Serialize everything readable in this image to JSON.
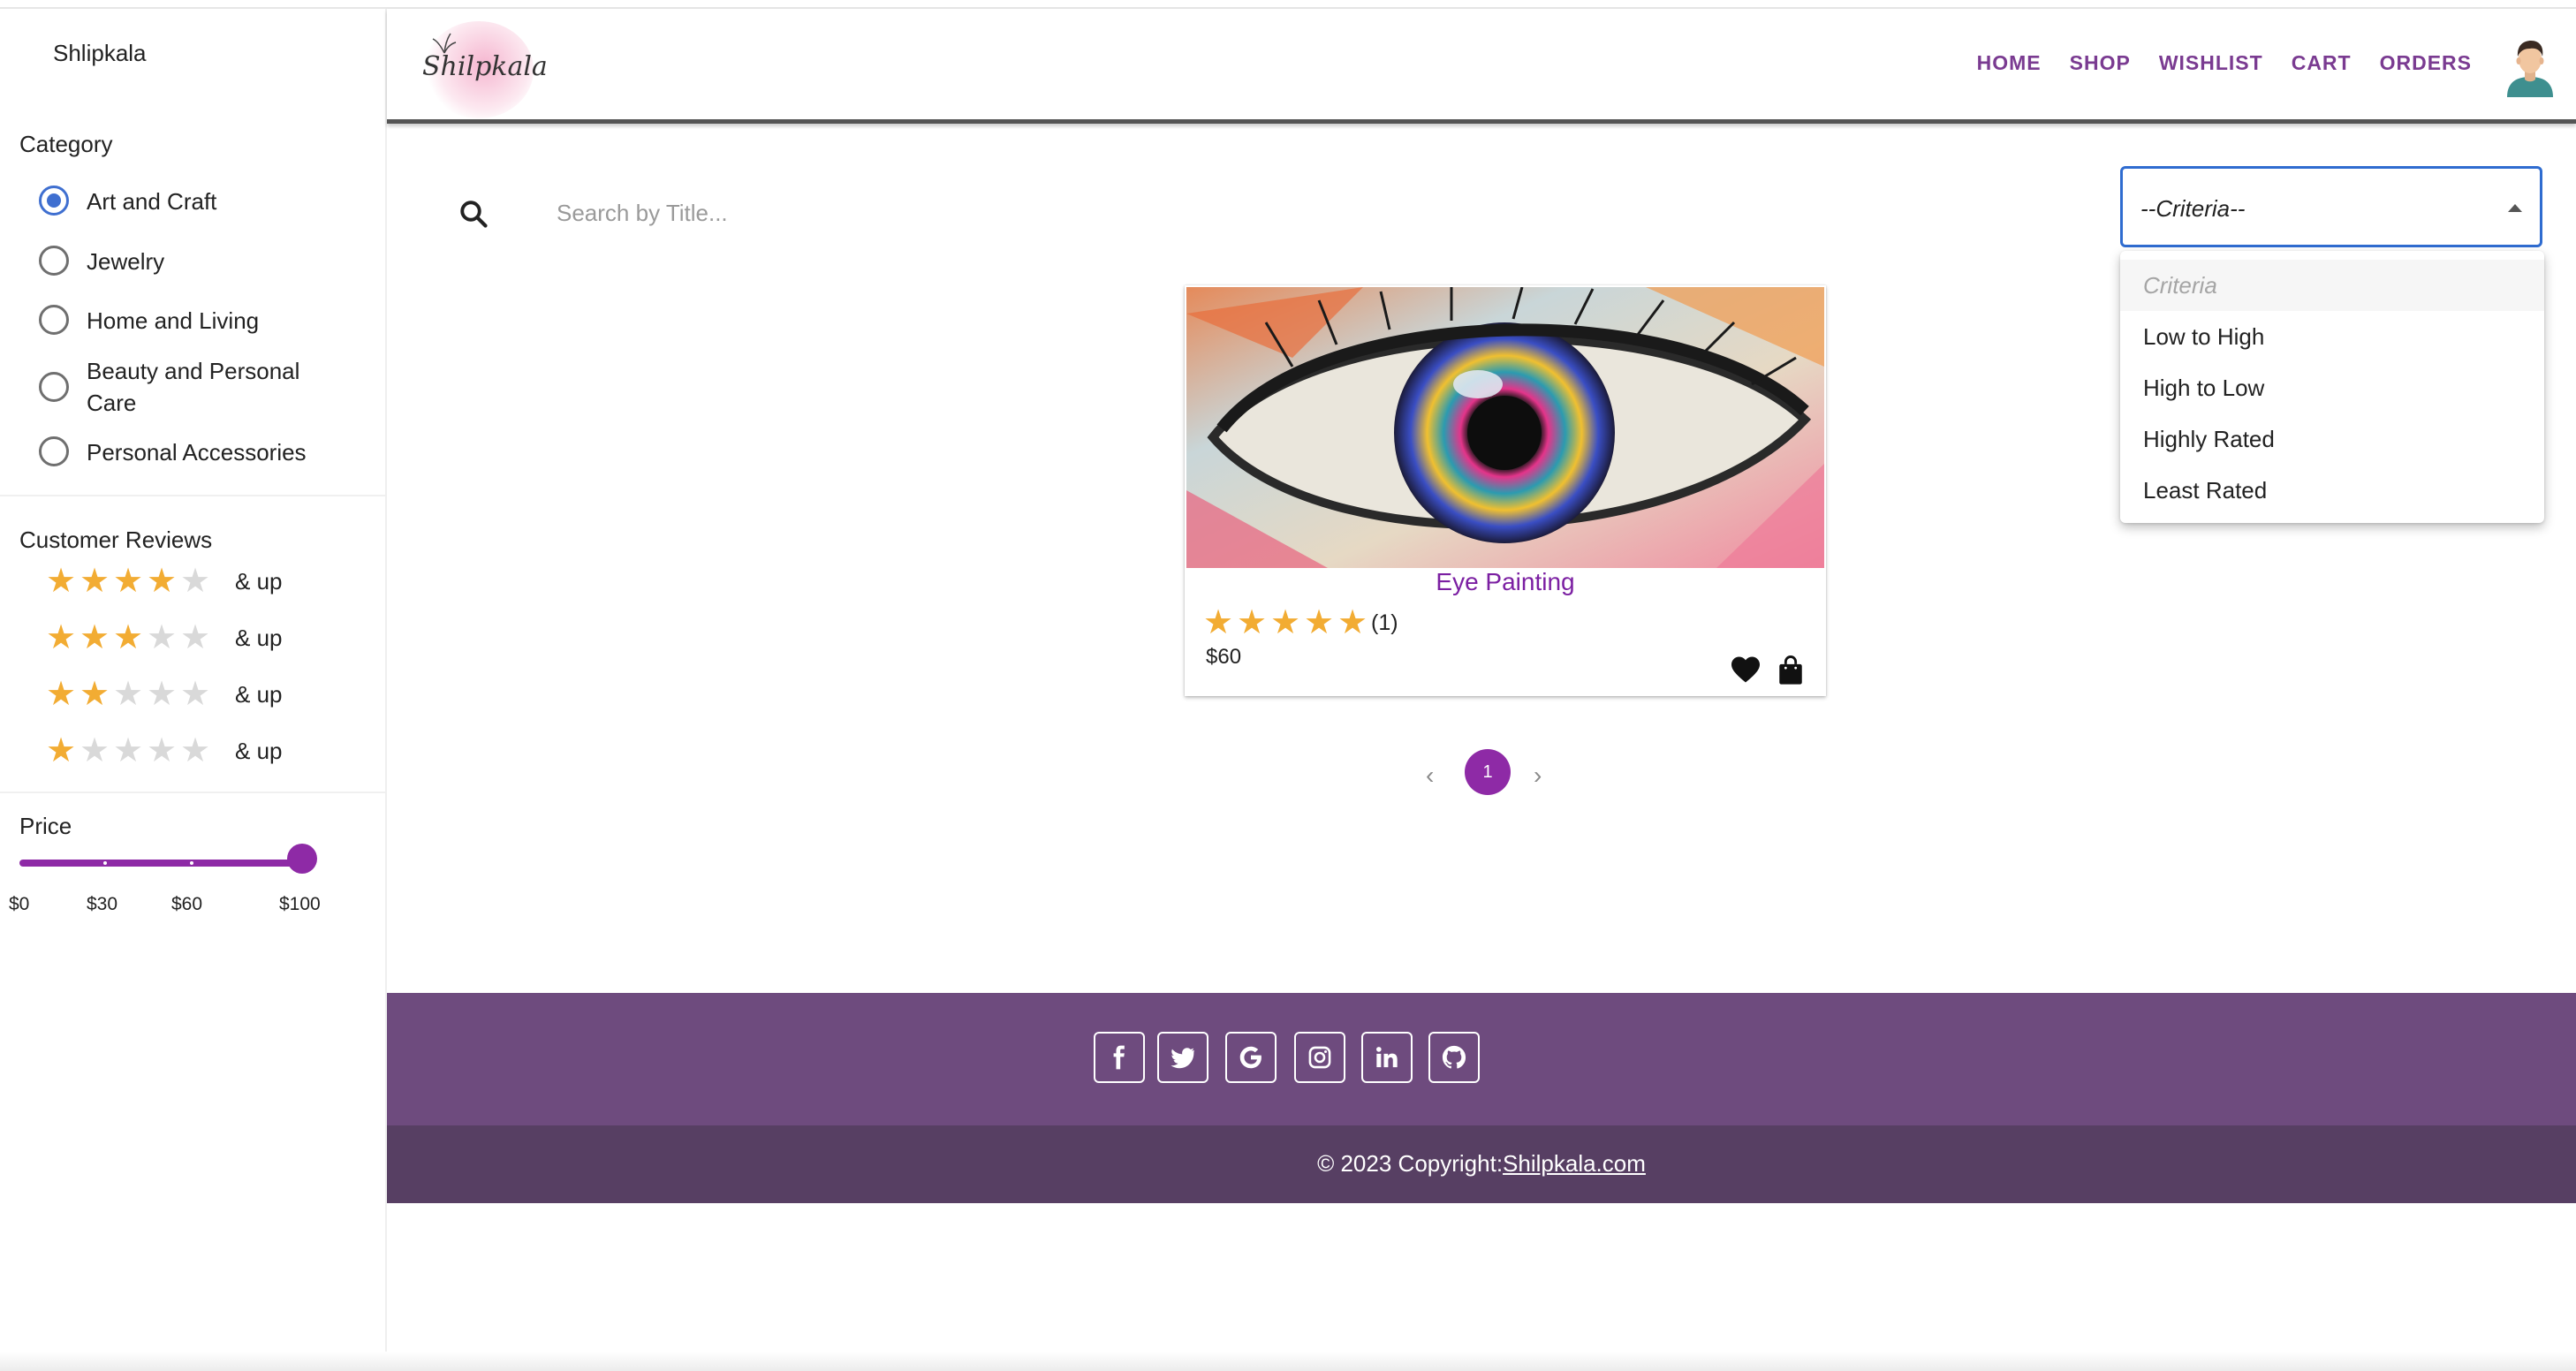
{
  "sidebar": {
    "brand": "Shlipkala",
    "category_title": "Category",
    "categories": [
      {
        "label": "Art and Craft",
        "selected": true
      },
      {
        "label": "Jewelry",
        "selected": false
      },
      {
        "label": "Home and Living",
        "selected": false
      },
      {
        "label": "Beauty and Personal Care",
        "selected": false
      },
      {
        "label": "Personal Accessories",
        "selected": false
      }
    ],
    "reviews_title": "Customer Reviews",
    "reviews": [
      {
        "stars": 4,
        "label": "& up"
      },
      {
        "stars": 3,
        "label": "& up"
      },
      {
        "stars": 2,
        "label": "& up"
      },
      {
        "stars": 1,
        "label": "& up"
      }
    ],
    "price_title": "Price",
    "price_slider": {
      "min": 0,
      "max": 100,
      "value": 100,
      "marks": [
        "$0",
        "$30",
        "$60",
        "$100"
      ]
    }
  },
  "header": {
    "logo_text": "Shilpkala",
    "nav": [
      "HOME",
      "SHOP",
      "WISHLIST",
      "CART",
      "ORDERS"
    ]
  },
  "search": {
    "placeholder": "Search by Title..."
  },
  "sort": {
    "selected": "--Criteria--",
    "options": [
      "Criteria",
      "Low to High",
      "High to Low",
      "Highly Rated",
      "Least Rated"
    ]
  },
  "product": {
    "title": "Eye Painting",
    "rating": 5,
    "rating_count": "(1)",
    "price": "$60"
  },
  "pagination": {
    "current": "1",
    "prev": "‹",
    "next": "›"
  },
  "footer": {
    "social_icons": [
      "facebook-icon",
      "twitter-icon",
      "google-icon",
      "instagram-icon",
      "linkedin-icon",
      "github-icon"
    ],
    "copyright_prefix": "© 2023 Copyright:",
    "copyright_link": "Shilpkala.com"
  },
  "colors": {
    "accent": "#8e2aa6",
    "nav_text": "#7a3b91",
    "star": "#f2ac33",
    "select_border": "#2f6cd0",
    "footer_top": "#6e4b7e",
    "footer_bottom": "#573f63"
  }
}
